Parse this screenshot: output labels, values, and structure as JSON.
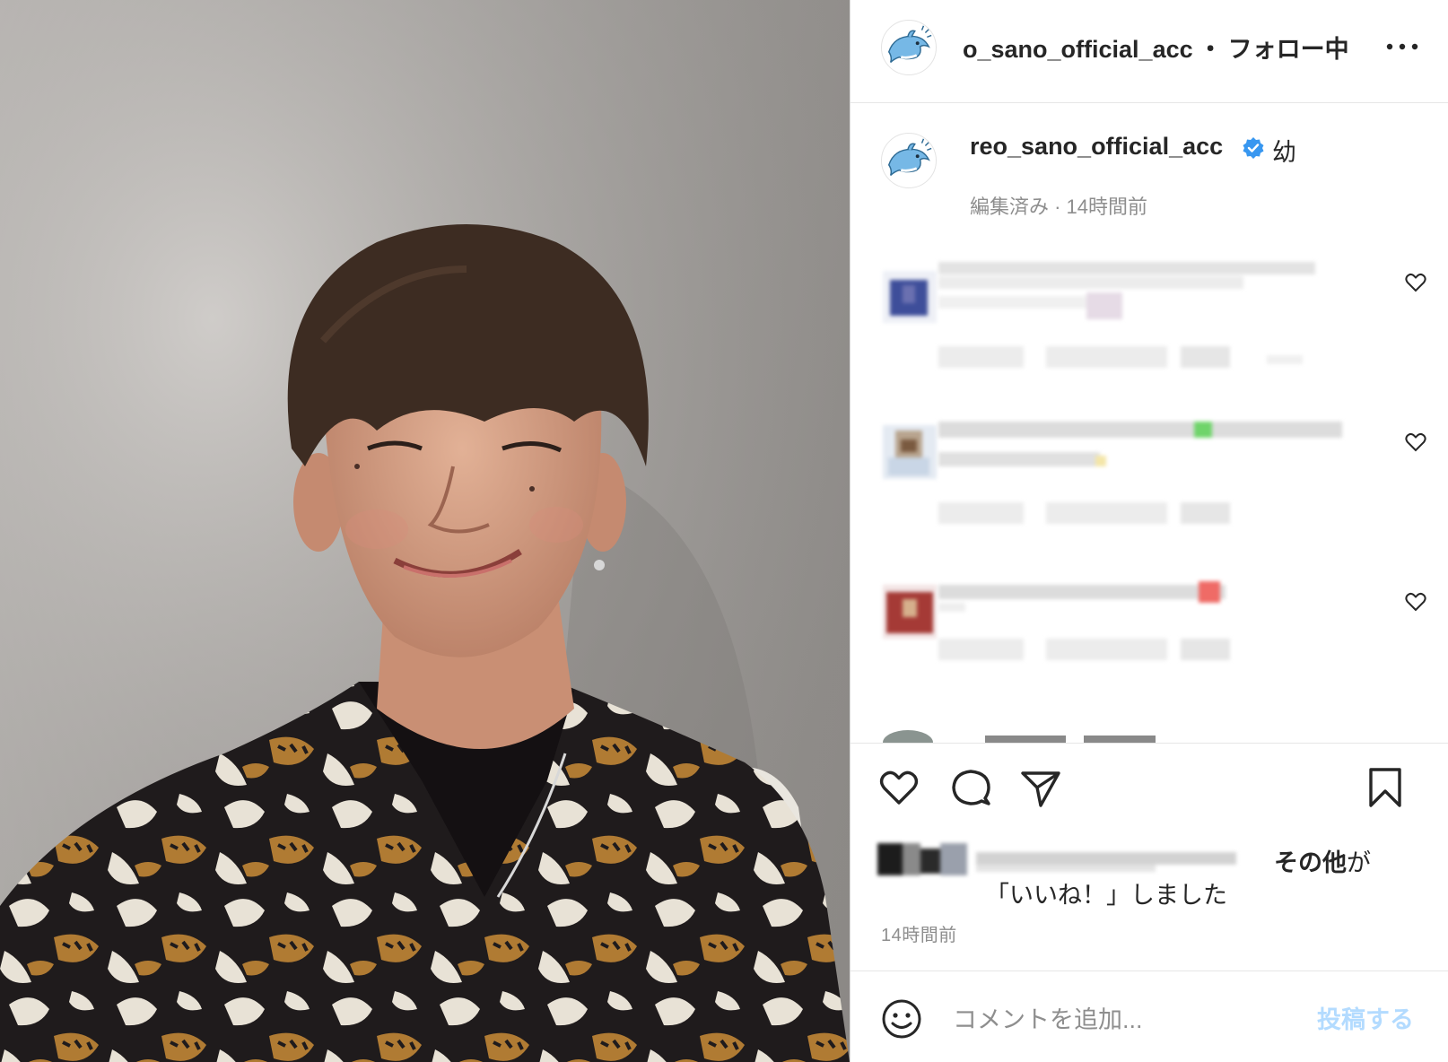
{
  "header": {
    "username": "o_sano_official_acc",
    "separator": "・",
    "follow_status": "フォロー中"
  },
  "caption": {
    "username": "reo_sano_official_acc",
    "text": "幼",
    "meta": "編集済み · 14時間前"
  },
  "actions": {
    "liked_by_suffix": "その他",
    "liked_by_particle": "が",
    "liked_by_line2": "「いいね！」しました",
    "timestamp": "14時間前"
  },
  "comment_box": {
    "placeholder": "コメントを追加...",
    "post_label": "投稿する"
  },
  "colors": {
    "verified_badge": "#3897f0",
    "post_button_disabled": "#b3dbff",
    "muted_text": "#8e8e8e"
  }
}
